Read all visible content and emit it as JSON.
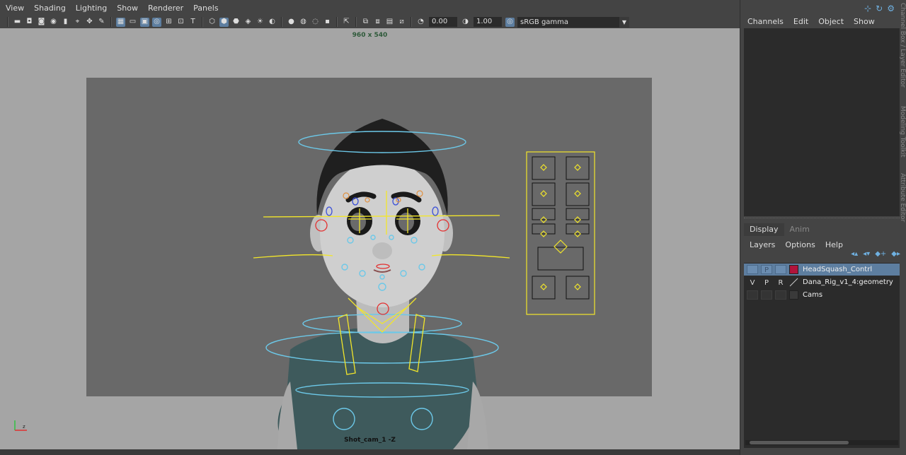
{
  "menubar": {
    "items": [
      "View",
      "Shading",
      "Lighting",
      "Show",
      "Renderer",
      "Panels"
    ]
  },
  "toolbar": {
    "exposure_value": "0.00",
    "gamma_value": "1.00",
    "color_space": "sRGB gamma",
    "icons": [
      "camera-icon",
      "bookmark-icon",
      "grid-icon",
      "wireframe-icon",
      "smooth-shade-icon",
      "textured-icon",
      "light-icon",
      "xray-icon",
      "isolate-icon",
      "exposure-icon",
      "gamma-icon",
      "color-space-icon"
    ]
  },
  "viewport": {
    "resolution": "960 x 540",
    "camera_name": "Shot_cam_1 -Z",
    "colors": {
      "canvas": "#a5a5a5",
      "gate": "#696969",
      "control_yellow": "#f2e62a",
      "control_cyan": "#6cc8e8",
      "control_red": "#e33030"
    }
  },
  "channel_box": {
    "menu": [
      "Channels",
      "Edit",
      "Object",
      "Show"
    ]
  },
  "layers": {
    "tabs": [
      {
        "label": "Display",
        "active": true
      },
      {
        "label": "Anim",
        "active": false
      }
    ],
    "menu": [
      "Layers",
      "Options",
      "Help"
    ],
    "rows": [
      {
        "v": "",
        "p": "P",
        "r": "",
        "color": "#b0143c",
        "name": "HeadSquash_Contrl",
        "selected": true
      },
      {
        "v": "V",
        "p": "P",
        "r": "R",
        "color": "",
        "name": "Dana_Rig_v1_4:geometry",
        "selected": false
      },
      {
        "v": "",
        "p": "",
        "r": "",
        "color": "#3a3a3a",
        "name": "Cams",
        "selected": false
      }
    ]
  },
  "side_tabs": [
    "Channel Box / Layer Editor",
    "Modeling Toolkit",
    "Attribute Editor"
  ]
}
